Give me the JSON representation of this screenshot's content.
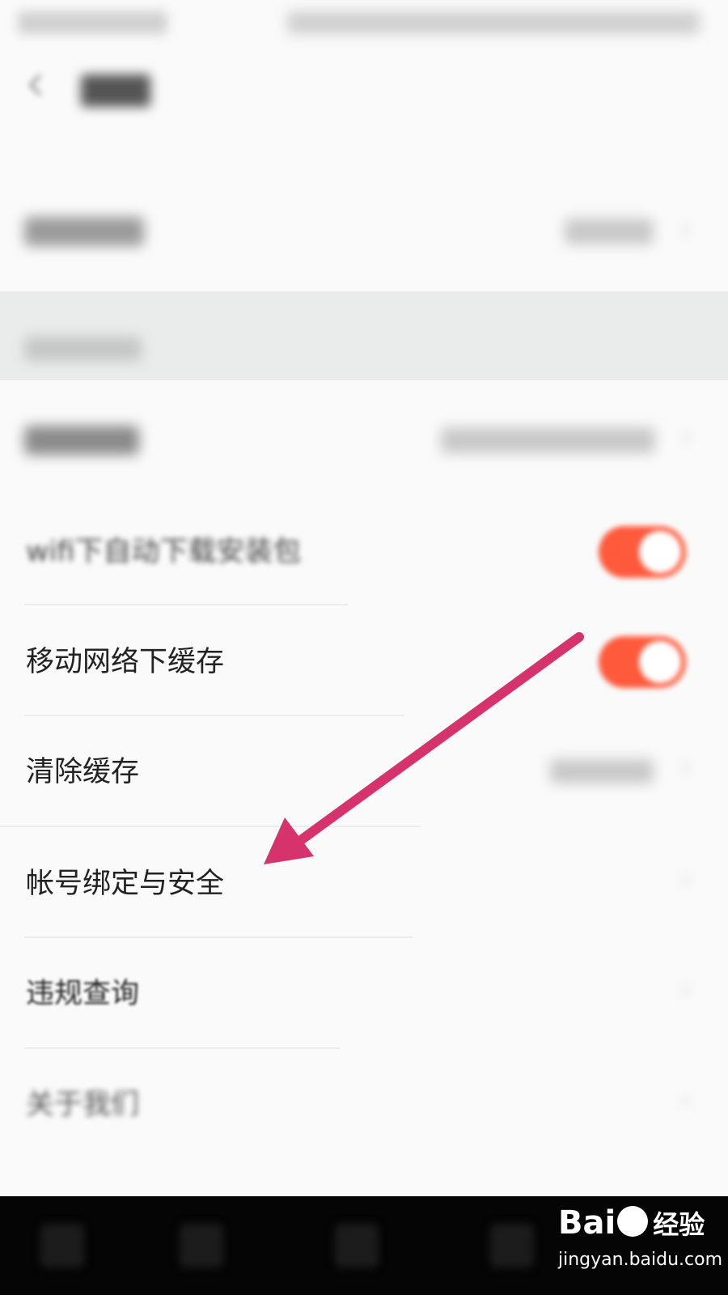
{
  "settings": {
    "items": [
      {
        "label": "wifi下自动下载安装包"
      },
      {
        "label": "移动网络下缓存"
      },
      {
        "label": "清除缓存"
      },
      {
        "label": "帐号绑定与安全"
      },
      {
        "label": "违规查询"
      },
      {
        "label": "关于我们"
      }
    ],
    "toggles": {
      "wifi_auto_download": true,
      "mobile_network_cache": true
    },
    "accent_color": "#ff5a3c"
  },
  "annotation": {
    "arrow_color": "#d6336c"
  },
  "watermark": {
    "brand": "Bai",
    "brand_suffix": "经验",
    "url": "jingyan.baidu.com"
  }
}
